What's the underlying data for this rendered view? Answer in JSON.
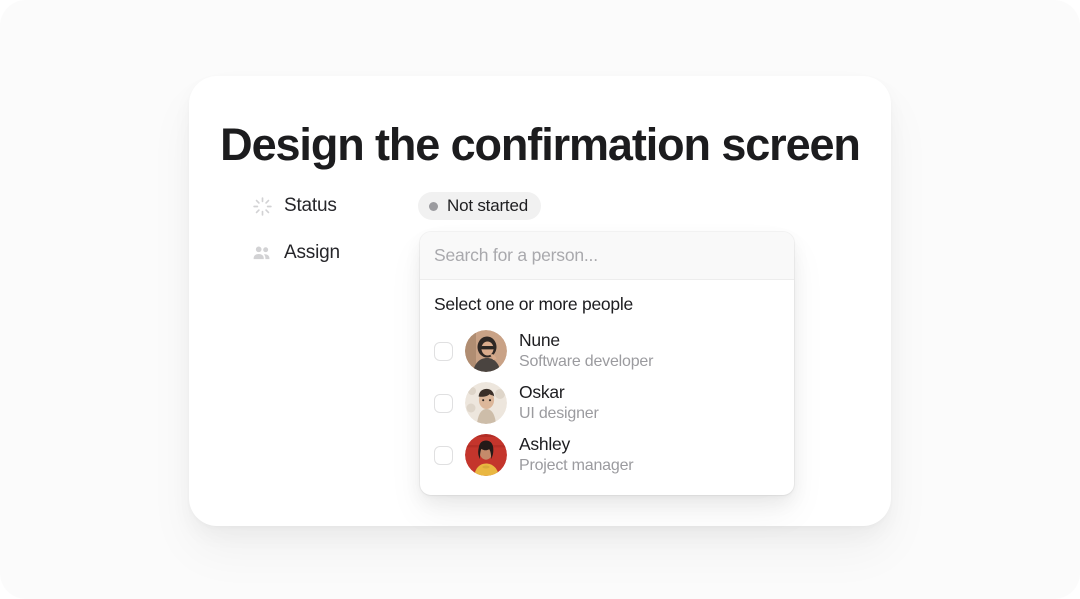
{
  "card": {
    "title": "Design the confirmation screen",
    "properties": [
      {
        "icon": "spinner-icon",
        "label": "Status",
        "value_type": "status-badge",
        "value": "Not started",
        "dot_color": "#9b9b9f",
        "badge_bg": "#f1f1f1"
      },
      {
        "icon": "people-icon",
        "label": "Assign",
        "value_type": "person-picker",
        "value": ""
      }
    ]
  },
  "dropdown": {
    "search": {
      "placeholder": "Search for a person...",
      "value": "",
      "icon": "search-input"
    },
    "heading": "Select one or more people",
    "people": [
      {
        "name": "Nune",
        "role": "Software developer",
        "checked": false,
        "avatar": {
          "name": "avatar-nune",
          "bg": "#c9a286",
          "hair": "#2e2724",
          "skin": "#d9ab8c",
          "clothes": "#4a4440"
        }
      },
      {
        "name": "Oskar",
        "role": "UI designer",
        "checked": false,
        "avatar": {
          "name": "avatar-oskar",
          "bg": "#ede6dd",
          "hair": "#3a2f28",
          "skin": "#dcb79a",
          "clothes": "#cdbda9"
        }
      },
      {
        "name": "Ashley",
        "role": "Project manager",
        "checked": false,
        "avatar": {
          "name": "avatar-ashley",
          "bg": "#c4352c",
          "hair": "#241a18",
          "skin": "#c58a6a",
          "clothes": "#e9b741"
        }
      }
    ]
  },
  "colors": {
    "page_bg": "#fbfbfb",
    "card_bg": "#ffffff",
    "title": "#1c1c1e",
    "muted_text": "#9b9b9f",
    "icon_gray": "#d2d2d4"
  }
}
